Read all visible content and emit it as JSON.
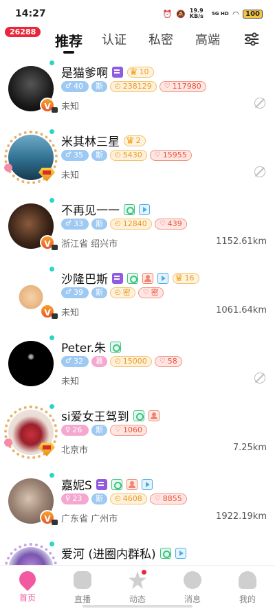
{
  "status_bar": {
    "time": "14:27",
    "net_speed": "19.9 KB/s",
    "network": "5G HD",
    "battery": "100"
  },
  "header": {
    "unread_badge": "26288",
    "tabs": [
      {
        "label": "推荐",
        "active": true
      },
      {
        "label": "认证",
        "active": false
      },
      {
        "label": "私密",
        "active": false
      },
      {
        "label": "高端",
        "active": false
      }
    ],
    "filter_icon": "filter-sliders-icon"
  },
  "users": [
    {
      "name": "是猫爹啊",
      "age": "40",
      "sign": "斯",
      "wealth": "238129",
      "charm": "117980",
      "gender": "male",
      "crown_level": "10",
      "location": "未知",
      "distance": "",
      "hidden": true
    },
    {
      "name": "米其林三星",
      "age": "35",
      "sign": "斯",
      "wealth": "5430",
      "charm": "15955",
      "gender": "male",
      "crown_level": "2",
      "location": "未知",
      "distance": "",
      "hidden": true
    },
    {
      "name": "不再见一一",
      "age": "33",
      "sign": "斯",
      "wealth": "12840",
      "charm": "439",
      "gender": "male",
      "crown_level": "",
      "location": "浙江省 绍兴市",
      "distance": "1152.61km",
      "hidden": false
    },
    {
      "name": "沙隆巴斯",
      "age": "39",
      "sign": "斯",
      "wealth": "密",
      "charm": "密",
      "gender": "male",
      "crown_level": "16",
      "location": "未知",
      "distance": "1061.64km",
      "hidden": false
    },
    {
      "name": "Peter.朱",
      "age": "32",
      "sign": "慕",
      "wealth": "15000",
      "charm": "58",
      "gender": "male",
      "crown_level": "",
      "location": "未知",
      "distance": "",
      "hidden": true
    },
    {
      "name": "si爱女王驾到",
      "age": "26",
      "sign": "斯",
      "wealth": "",
      "charm": "1060",
      "gender": "female",
      "crown_level": "",
      "location": "北京市",
      "distance": "7.25km",
      "hidden": false
    },
    {
      "name": "嘉妮S",
      "age": "23",
      "sign": "斯",
      "wealth": "4608",
      "charm": "8855",
      "gender": "female",
      "crown_level": "",
      "location": "广东省 广州市",
      "distance": "1922.19km",
      "hidden": false
    },
    {
      "name": "爱河 (进圈内群私)",
      "age": "",
      "sign": "",
      "wealth": "",
      "charm": "",
      "gender": "female",
      "crown_level": "",
      "location": "",
      "distance": "",
      "hidden": false
    }
  ],
  "bottom_nav": [
    {
      "label": "首页",
      "icon": "home-pin-icon",
      "active": true
    },
    {
      "label": "直播",
      "icon": "tv-icon",
      "active": false
    },
    {
      "label": "动态",
      "icon": "star-icon",
      "active": false
    },
    {
      "label": "消息",
      "icon": "chat-icon",
      "active": false
    },
    {
      "label": "我的",
      "icon": "person-icon",
      "active": false
    }
  ],
  "colors": {
    "accent": "#f15aa0",
    "online": "#2bd3c8",
    "badge_red": "#e8283a"
  }
}
